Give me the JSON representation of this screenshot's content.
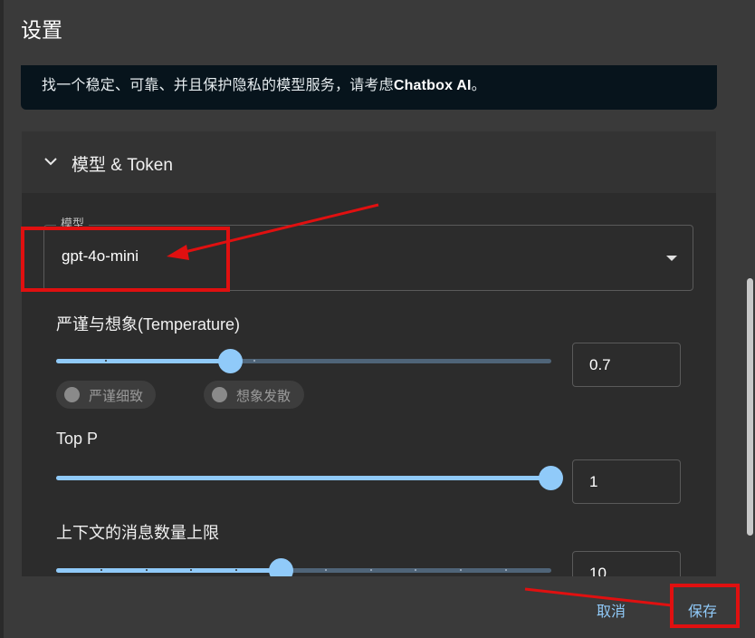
{
  "dialog": {
    "title": "设置"
  },
  "banner": {
    "text_prefix": "找一个稳定、可靠、并且保护隐私的模型服务，请考虑",
    "text_brand": "Chatbox AI",
    "text_suffix": "。"
  },
  "section": {
    "title": "模型 & Token",
    "expanded": true
  },
  "model": {
    "label": "模型",
    "value": "gpt-4o-mini"
  },
  "temperature": {
    "label": "严谨与想象(Temperature)",
    "value": "0.7",
    "slider_fraction": 0.35,
    "chip_strict": "严谨细致",
    "chip_imaginative": "想象发散"
  },
  "top_p": {
    "label": "Top P",
    "value": "1",
    "slider_fraction": 1.0
  },
  "context_limit": {
    "label": "上下文的消息数量上限",
    "value": "10",
    "slider_fraction": 0.45
  },
  "footer": {
    "cancel_label": "取消",
    "save_label": "保存"
  },
  "colors": {
    "accent": "#90caf9",
    "annotation_red": "#e01010",
    "banner_bg": "#07141c"
  }
}
